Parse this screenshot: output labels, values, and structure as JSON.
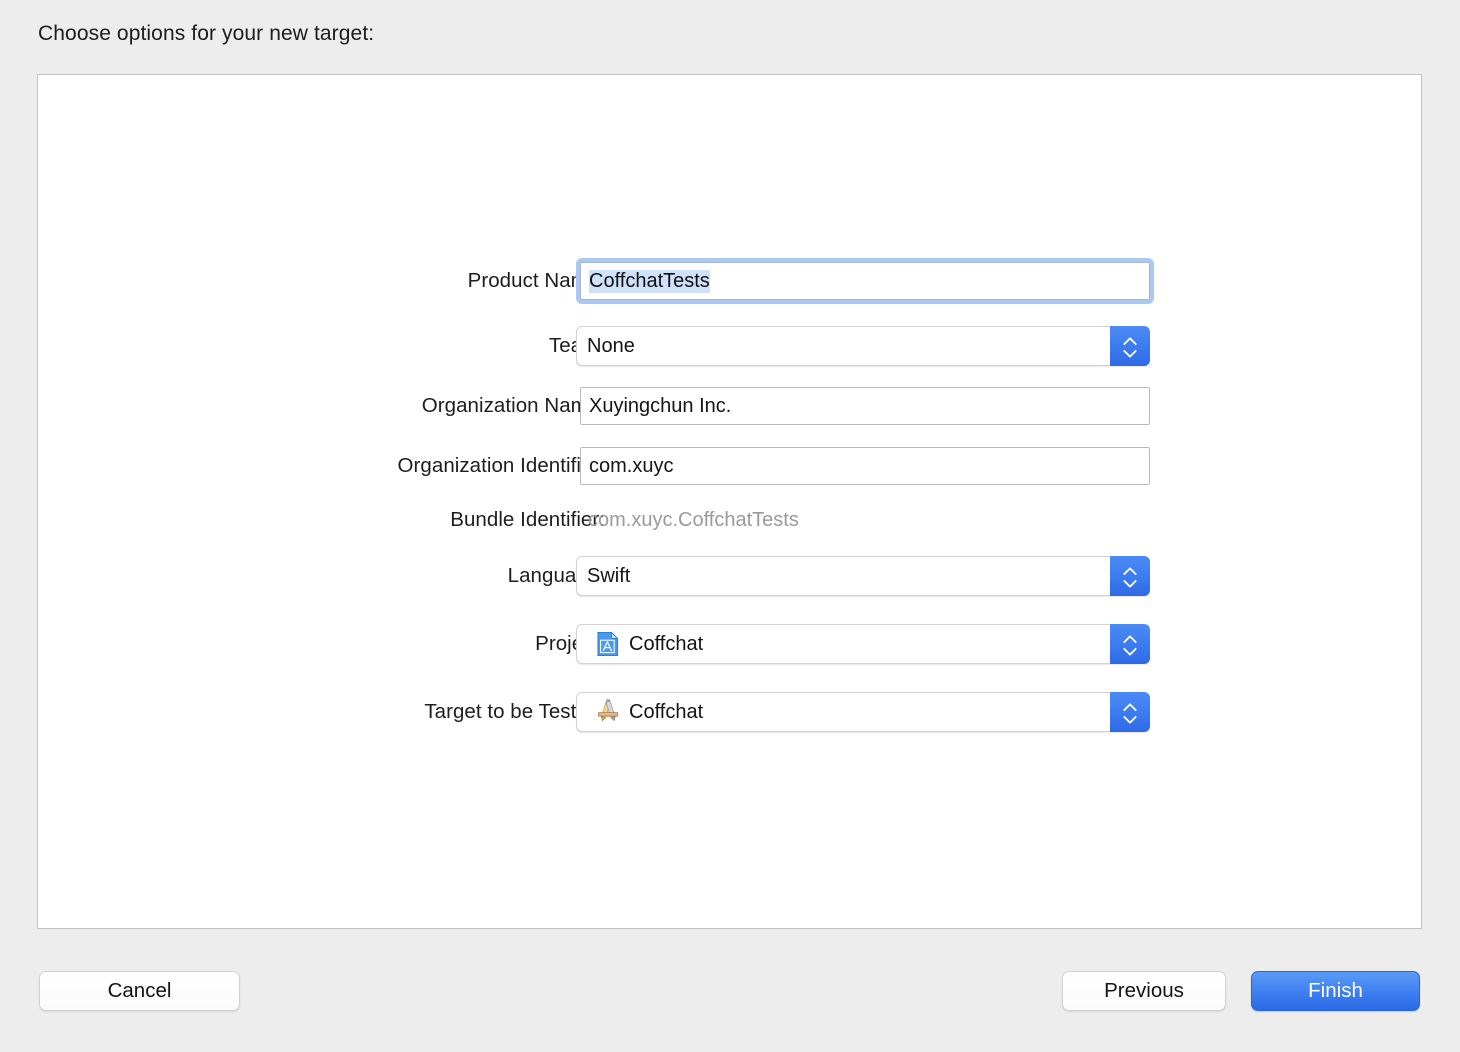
{
  "header": {
    "title": "Choose options for your new target:"
  },
  "form": {
    "rows": [
      {
        "label": "Product Name:",
        "type": "textfield-focused",
        "value": "CoffchatTests",
        "placeholder": "",
        "name": "product-name"
      },
      {
        "label": "Team:",
        "type": "popup",
        "value": "None",
        "name": "team"
      },
      {
        "label": "Organization Name:",
        "type": "textfield",
        "value": "Xuyingchun Inc.",
        "placeholder": "",
        "name": "organization-name"
      },
      {
        "label": "Organization Identifier:",
        "type": "textfield",
        "value": "com.xuyc",
        "placeholder": "",
        "name": "organization-identifier"
      },
      {
        "label": "Bundle Identifier:",
        "type": "static",
        "value": "com.xuyc.CoffchatTests",
        "name": "bundle-identifier"
      },
      {
        "label": "Language:",
        "type": "popup",
        "value": "Swift",
        "name": "language"
      },
      {
        "label": "Project:",
        "type": "popup-icon",
        "value": "Coffchat",
        "icon": "xcode-project-document-icon",
        "name": "project"
      },
      {
        "label": "Target to be Tested:",
        "type": "popup-icon",
        "value": "Coffchat",
        "icon": "xcode-app-target-icon",
        "name": "target-to-be-tested"
      }
    ],
    "stepper_icon_up": "chevron-up-icon",
    "stepper_icon_down": "chevron-down-icon"
  },
  "footer": {
    "cancel_label": "Cancel",
    "previous_label": "Previous",
    "finish_label": "Finish"
  },
  "colors": {
    "window_background": "#ededed",
    "panel_background": "#ffffff",
    "panel_border": "#c3c3c3",
    "accent_blue": "#3f81f1",
    "stepper_blue": "#3d7cf0",
    "focus_ring": "#a9c8f2",
    "selection_highlight": "#cfe1fb",
    "static_text": "#9a9a9a",
    "label_text": "#1d1d1d"
  }
}
